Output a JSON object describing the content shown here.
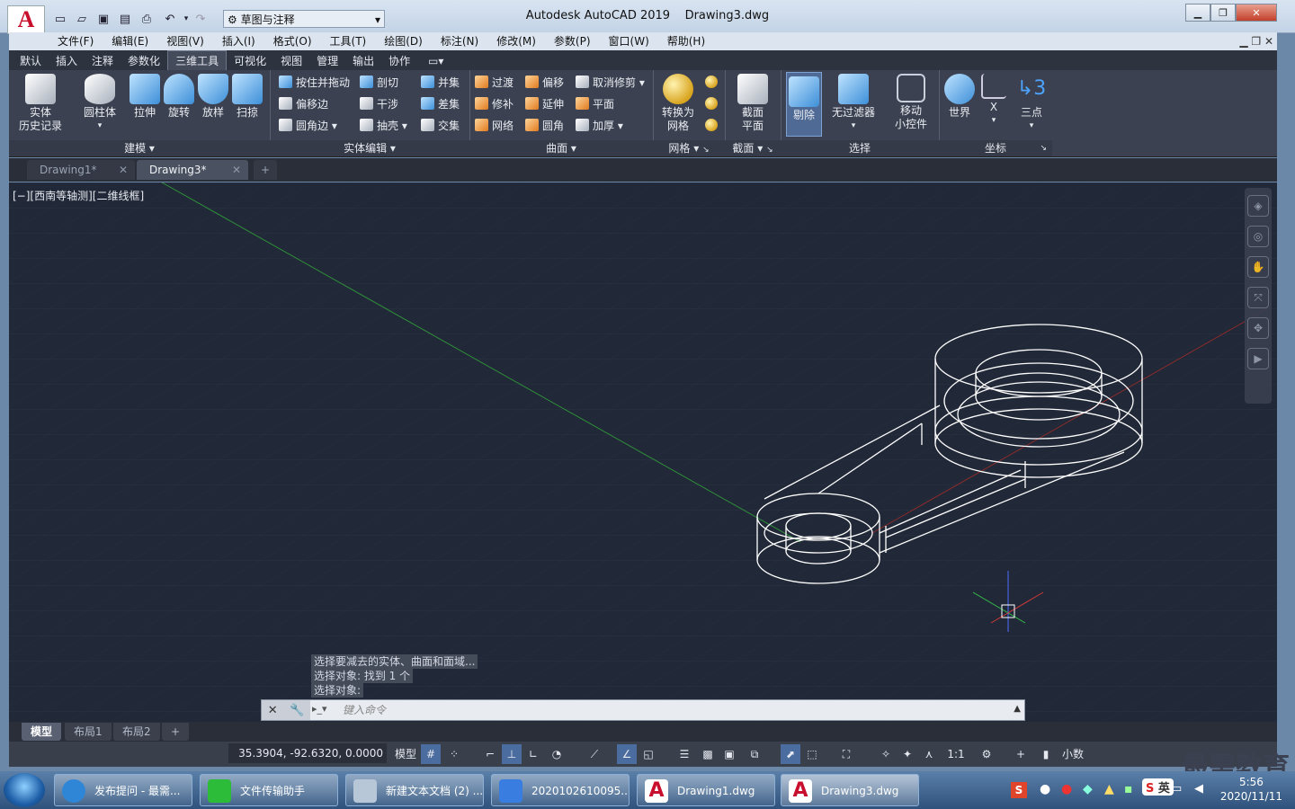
{
  "window": {
    "title": "Autodesk AutoCAD 2019",
    "file": "Drawing3.dwg",
    "workspace": "草图与注释",
    "app_logo": "A"
  },
  "menu": [
    "文件(F)",
    "编辑(E)",
    "视图(V)",
    "插入(I)",
    "格式(O)",
    "工具(T)",
    "绘图(D)",
    "标注(N)",
    "修改(M)",
    "参数(P)",
    "窗口(W)",
    "帮助(H)"
  ],
  "ribbon_tabs": [
    "默认",
    "插入",
    "注释",
    "参数化",
    "三维工具",
    "可视化",
    "视图",
    "管理",
    "输出",
    "协作"
  ],
  "ribbon_active": "三维工具",
  "ribbon": {
    "modeling": {
      "title": "建模",
      "buttons": [
        "实体\n历史记录",
        "圆柱体",
        "拉伸",
        "旋转",
        "放样",
        "扫掠"
      ]
    },
    "solid_edit": {
      "title": "实体编辑",
      "items": [
        "按住并拖动",
        "偏移边",
        "圆角边",
        "剖切",
        "干涉",
        "抽壳",
        "并集",
        "差集",
        "交集"
      ]
    },
    "surface": {
      "title": "曲面",
      "items": [
        "过渡",
        "偏移",
        "取消修剪",
        "修补",
        "延伸",
        "平面",
        "网络",
        "圆角",
        "加厚"
      ]
    },
    "mesh": {
      "title": "网格",
      "button": "转换为\n网格"
    },
    "section": {
      "title": "截面",
      "button": "截面\n平面"
    },
    "selection": {
      "title": "选择",
      "buttons": [
        "剔除",
        "无过滤器",
        "移动\n小控件"
      ]
    },
    "coords": {
      "title": "坐标",
      "buttons": [
        "世界",
        "X",
        "三点"
      ]
    }
  },
  "doc_tabs": [
    "Drawing1*",
    "Drawing3*"
  ],
  "viewport_label": "[−][西南等轴测][二维线框]",
  "command_history": [
    "选择要减去的实体、曲面和面域...",
    "选择对象: 找到 1 个",
    "选择对象:"
  ],
  "command_placeholder": "键入命令",
  "layout_tabs": [
    "模型",
    "布局1",
    "布局2"
  ],
  "status": {
    "coords": "35.3904, -92.6320, 0.0000",
    "model": "模型",
    "scale": "1:1",
    "units": "小数"
  },
  "taskbar": {
    "tasks": [
      "发布提问 - 最需...",
      "文件传输助手",
      "新建文本文档 (2) ...",
      "2020102610095...",
      "Drawing1.dwg",
      "Drawing3.dwg"
    ],
    "ime": "英",
    "date": "2020/11/11",
    "time": "5:56"
  },
  "watermark": "最需教育"
}
